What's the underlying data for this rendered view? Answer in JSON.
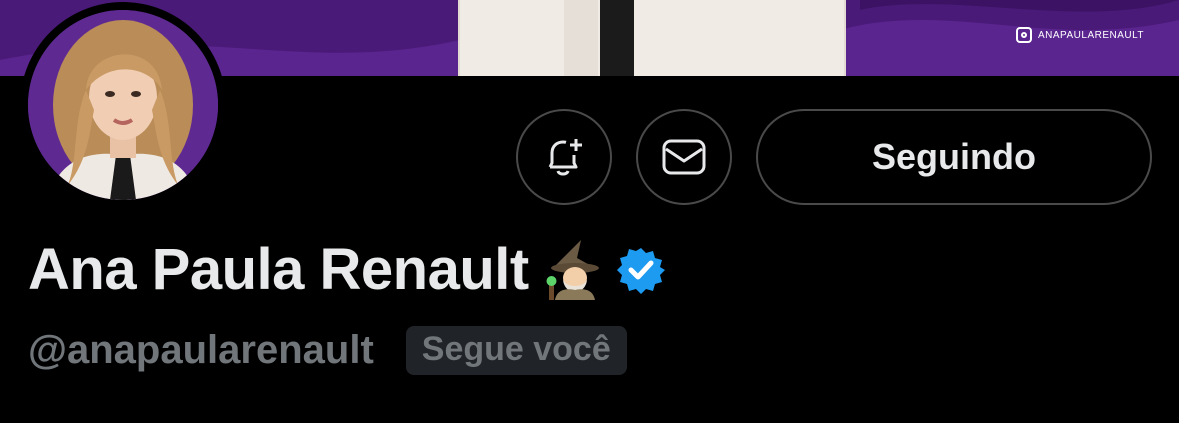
{
  "banner": {
    "instagram_handle": "ANAPAULARENAULT",
    "bg_color": "#4a1a78"
  },
  "actions": {
    "notify_icon": "bell-plus-icon",
    "message_icon": "envelope-icon",
    "follow_label": "Seguindo"
  },
  "profile": {
    "display_name": "Ana Paula Renault",
    "name_emoji": "🧙🏼‍♀️",
    "verified_icon": "verified-badge-icon",
    "verified_color": "#1d9bf0",
    "handle": "@anapaularenault",
    "follows_you_label": "Segue você"
  }
}
